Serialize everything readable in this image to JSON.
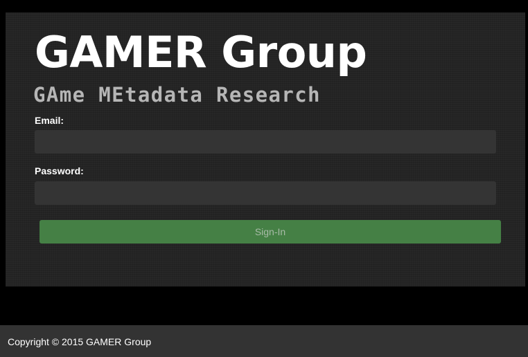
{
  "header": {
    "title": "GAMER Group",
    "subtitle": "GAme MEtadata Research"
  },
  "login_form": {
    "email_label": "Email:",
    "email_value": "",
    "password_label": "Password:",
    "password_value": "",
    "signin_label": "Sign-In"
  },
  "footer": {
    "copyright": "Copyright © 2015 GAMER Group"
  },
  "colors": {
    "background": "#000000",
    "panel": "#242424",
    "input_fill": "#343434",
    "signin_button": "#458045",
    "footer": "#333333"
  }
}
